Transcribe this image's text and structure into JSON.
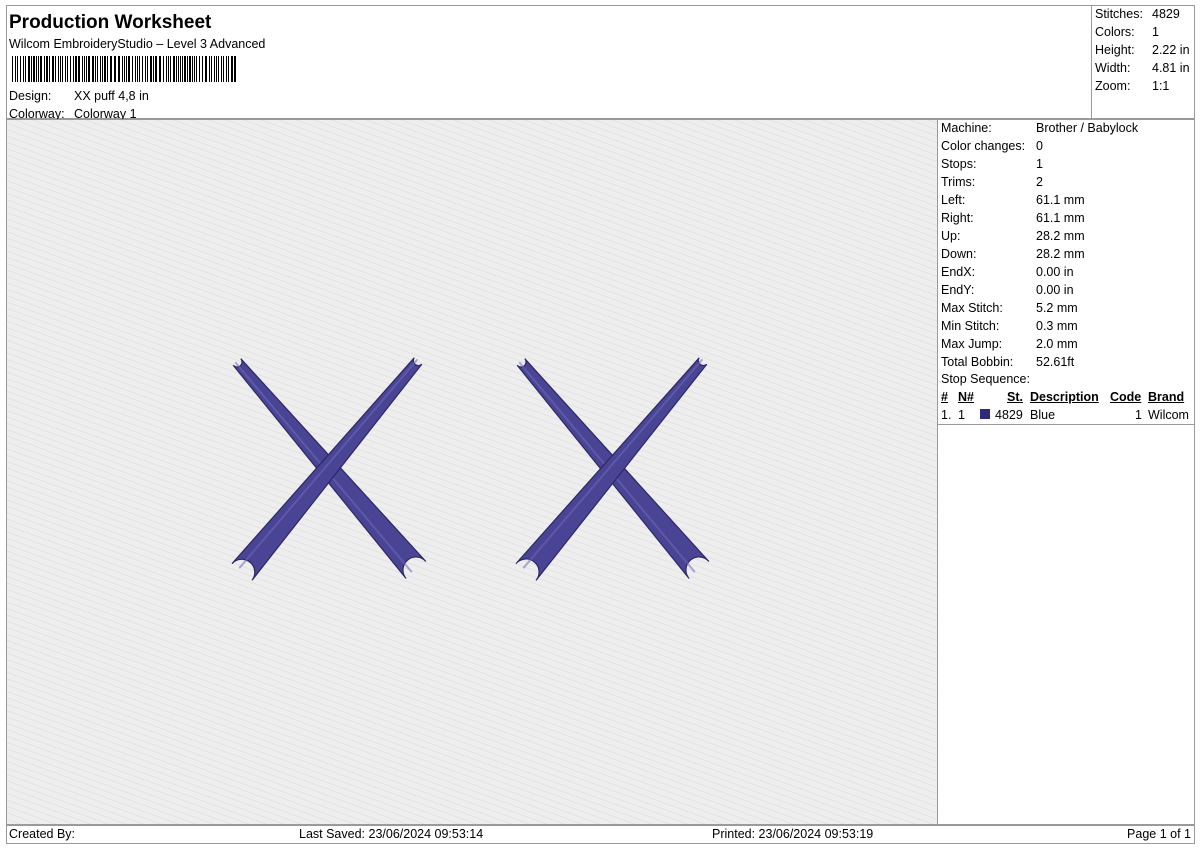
{
  "header": {
    "title": "Production Worksheet",
    "software": "Wilcom EmbroideryStudio – Level 3 Advanced",
    "design_label": "Design:",
    "design_value": "XX puff 4,8 in",
    "colorway_label": "Colorway:",
    "colorway_value": "Colorway 1"
  },
  "summary": [
    {
      "label": "Stitches:",
      "value": "4829"
    },
    {
      "label": "Colors:",
      "value": "1"
    },
    {
      "label": "Height:",
      "value": "2.22 in"
    },
    {
      "label": "Width:",
      "value": "4.81 in"
    },
    {
      "label": "Zoom:",
      "value": "1:1"
    }
  ],
  "machine_info": [
    {
      "label": "Machine:",
      "value": "Brother / Babylock"
    },
    {
      "label": "Color changes:",
      "value": "0"
    },
    {
      "label": "Stops:",
      "value": "1"
    },
    {
      "label": "Trims:",
      "value": "2"
    },
    {
      "label": "Left:",
      "value": "61.1 mm"
    },
    {
      "label": "Right:",
      "value": "61.1 mm"
    },
    {
      "label": "Up:",
      "value": "28.2 mm"
    },
    {
      "label": "Down:",
      "value": "28.2 mm"
    },
    {
      "label": "EndX:",
      "value": "0.00 in"
    },
    {
      "label": "EndY:",
      "value": "0.00 in"
    },
    {
      "label": "Max Stitch:",
      "value": "5.2 mm"
    },
    {
      "label": "Min Stitch:",
      "value": "0.3 mm"
    },
    {
      "label": "Max Jump:",
      "value": "2.0 mm"
    },
    {
      "label": "Total Bobbin:",
      "value": "52.61ft"
    }
  ],
  "stop_sequence": {
    "title": "Stop Sequence:",
    "columns": {
      "num": "#",
      "n": "N#",
      "st": "St.",
      "description": "Description",
      "code": "Code",
      "brand": "Brand"
    },
    "rows": [
      {
        "num": "1.",
        "n": "1",
        "color": "#2e2a7a",
        "st": "4829",
        "description": "Blue",
        "code": "1",
        "brand": "Wilcom"
      }
    ]
  },
  "design": {
    "thread_color": "#4a4495",
    "thread_dark": "#2c2765",
    "thread_light": "#6f6ab8",
    "fabric_color": "#eeeeee"
  },
  "footer": {
    "created_by": "Created By:",
    "last_saved": "Last Saved: 23/06/2024 09:53:14",
    "printed": "Printed: 23/06/2024 09:53:19",
    "page": "Page 1 of 1"
  }
}
